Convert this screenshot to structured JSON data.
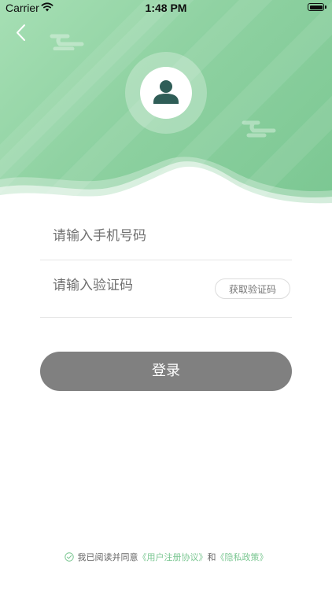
{
  "status_bar": {
    "carrier": "Carrier",
    "time": "1:48 PM"
  },
  "header": {
    "back_icon": "chevron-left-icon",
    "avatar_icon": "user-icon",
    "colors": {
      "gradient_start": "#a6dfb4",
      "gradient_end": "#7bc792",
      "avatar_figure": "#2f5d57"
    }
  },
  "form": {
    "phone_placeholder": "请输入手机号码",
    "code_placeholder": "请输入验证码",
    "get_code_label": "获取验证码",
    "login_label": "登录"
  },
  "agreement": {
    "prefix": "我已阅读并同意",
    "user_agreement": "《用户注册协议》",
    "conjunction": "和",
    "privacy_policy": "《隐私政策》",
    "accent_color": "#7bc792"
  }
}
